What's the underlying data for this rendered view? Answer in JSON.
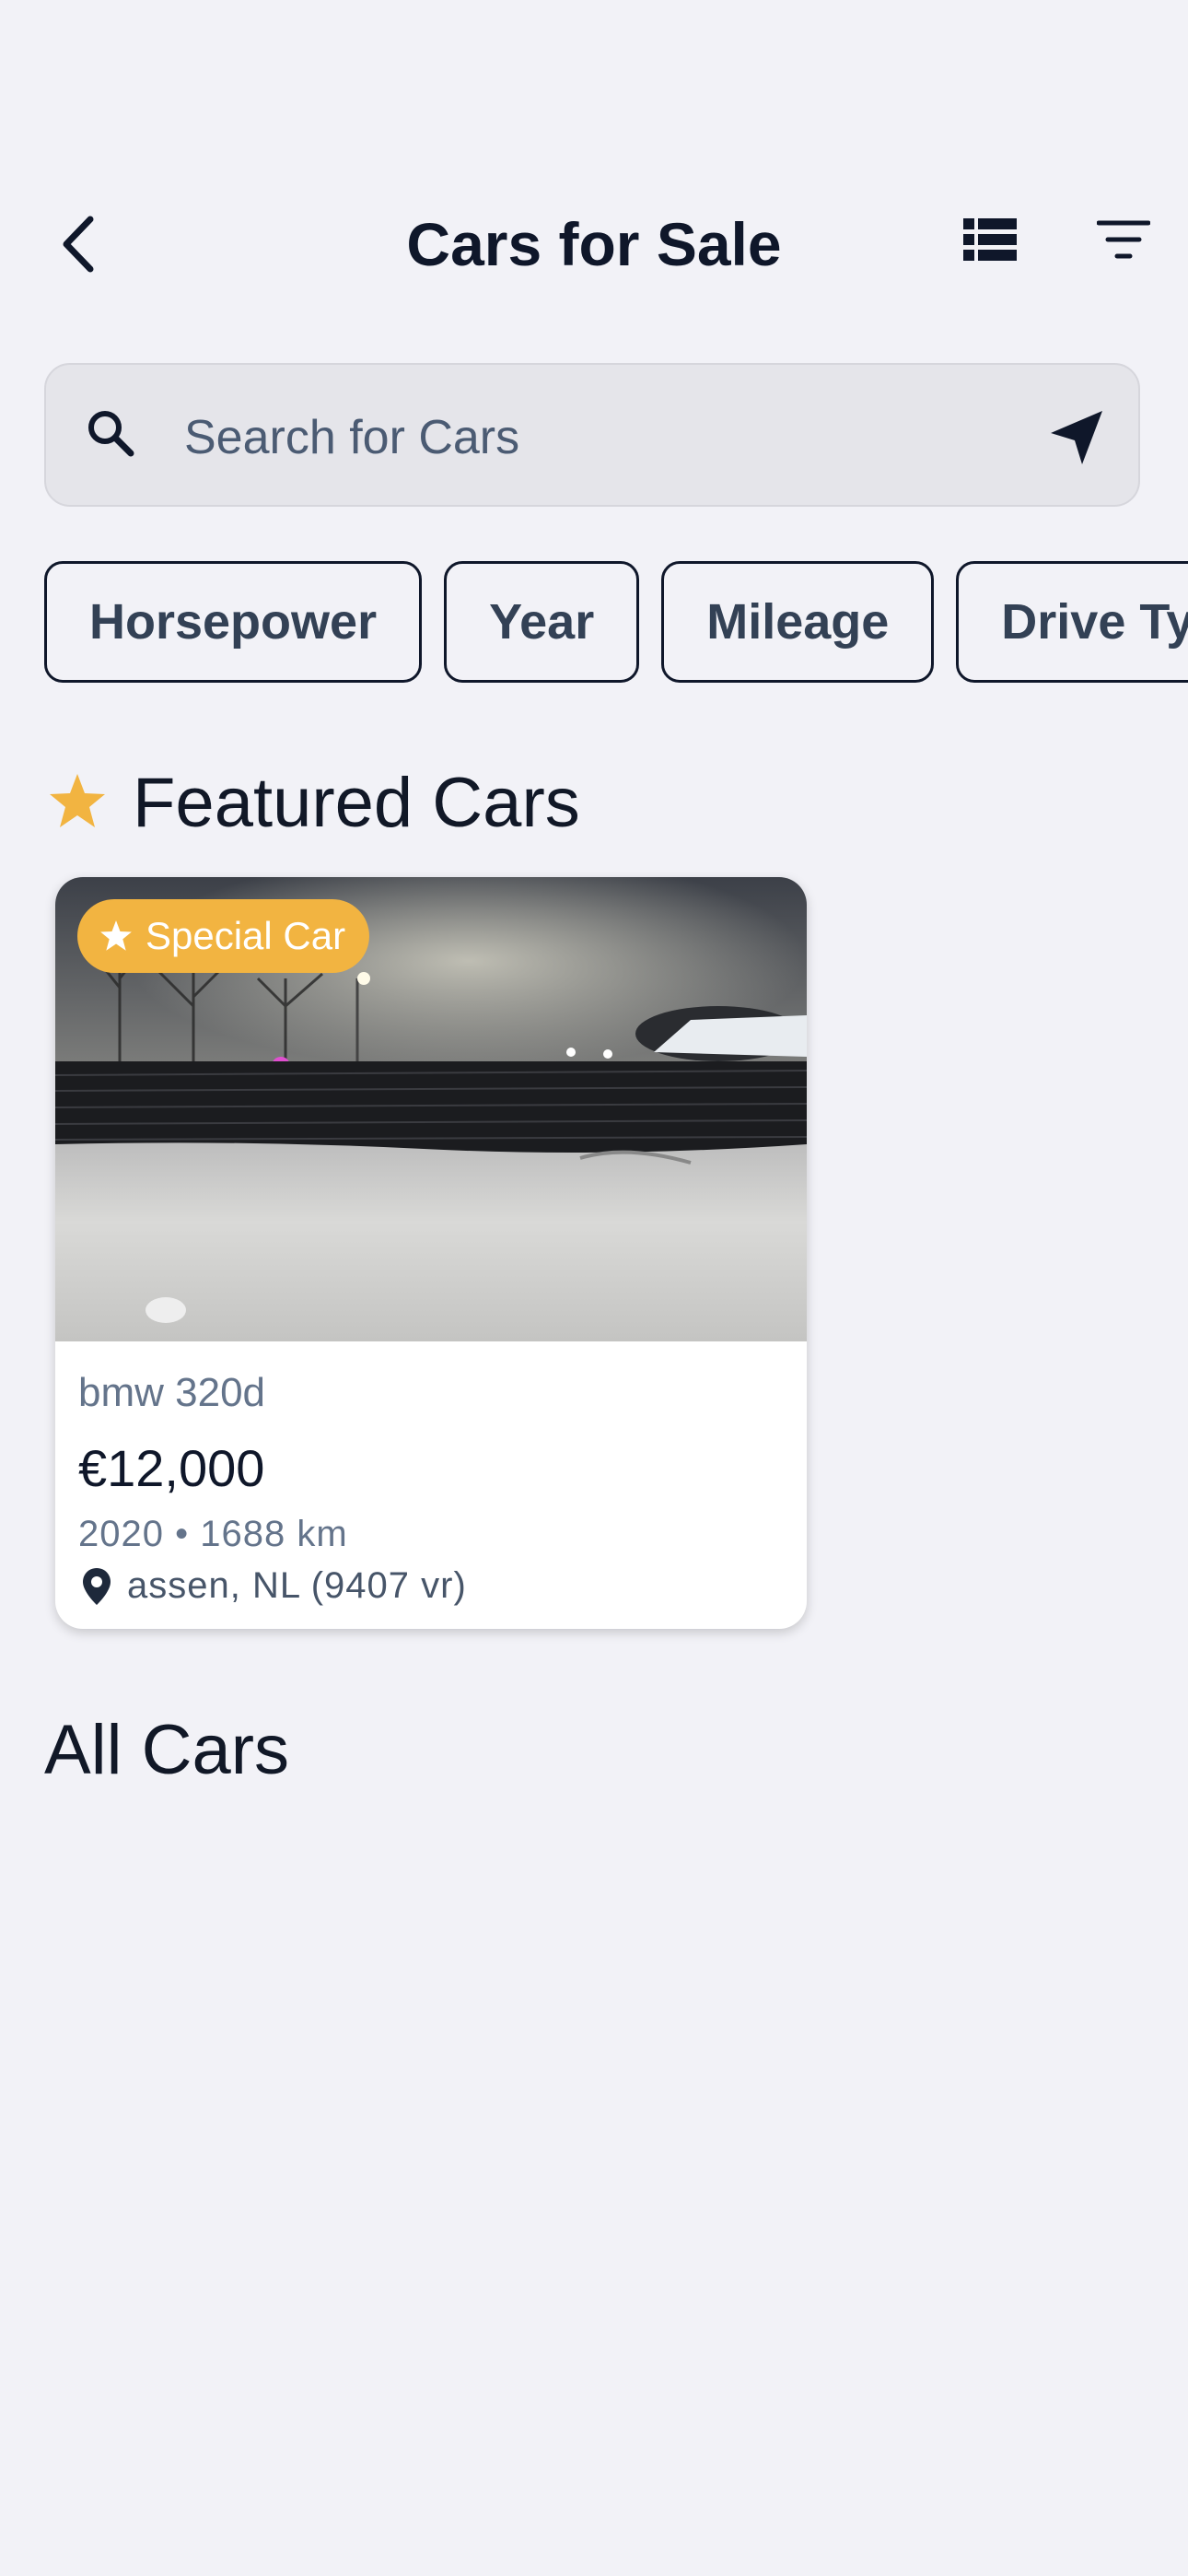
{
  "header": {
    "title": "Cars for Sale",
    "back_icon": "chevron-left-icon",
    "list_icon": "list-view-icon",
    "filter_icon": "filter-icon"
  },
  "search": {
    "placeholder": "Search for Cars",
    "value": "",
    "left_icon": "search-icon",
    "right_icon": "location-arrow-icon"
  },
  "filters": [
    "Horsepower",
    "Year",
    "Mileage",
    "Drive Type"
  ],
  "featured": {
    "title": "Featured Cars",
    "star_color": "#f2b441",
    "cars": [
      {
        "badge": "Special Car",
        "model": "bmw 320d",
        "price": "€12,000",
        "meta": "2020 • 1688 km",
        "location": "assen, NL (9407 vr)"
      }
    ]
  },
  "all_cars": {
    "title": "All Cars"
  },
  "colors": {
    "background": "#f2f2f7",
    "text_dark": "#0f172a",
    "accent": "#f2b441",
    "muted": "#64748b"
  }
}
